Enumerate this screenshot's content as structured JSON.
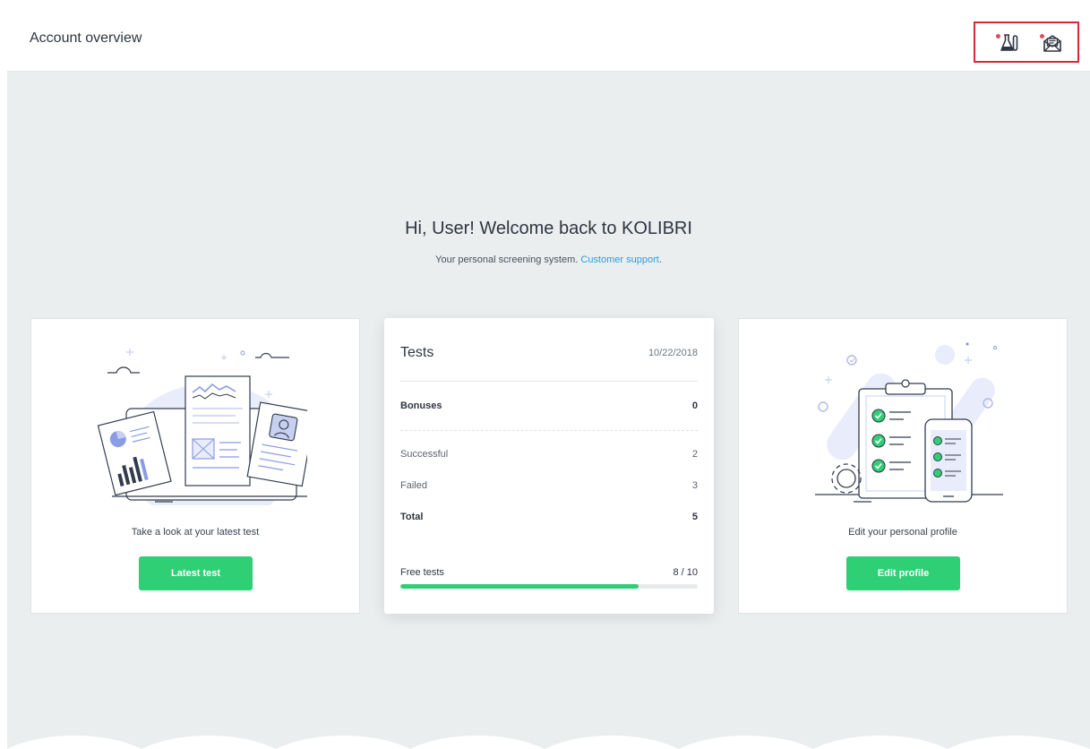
{
  "header": {
    "title": "Account overview",
    "icons": [
      "flask-icon",
      "message-icon"
    ],
    "highlight_color": "#d8273b"
  },
  "welcome": {
    "heading": "Hi, User! Welcome back to KOLIBRI",
    "subtitle_text": "Your personal screening system.",
    "support_link": "Customer support",
    "support_suffix": "."
  },
  "latest_card": {
    "caption": "Take a look at your latest test",
    "button_label": "Latest test"
  },
  "tests_card": {
    "title": "Tests",
    "date": "10/22/2018",
    "bonuses_label": "Bonuses",
    "bonuses_value": "0",
    "successful_label": "Successful",
    "successful_value": "2",
    "failed_label": "Failed",
    "failed_value": "3",
    "total_label": "Total",
    "total_value": "5",
    "free_tests_label": "Free tests",
    "free_tests_value": "8 / 10",
    "free_tests_fraction": 0.8
  },
  "profile_card": {
    "caption": "Edit your personal profile",
    "button_label": "Edit profile"
  },
  "colors": {
    "accent_green": "#2fcf75",
    "link_blue": "#2a9fd6",
    "background": "#ebeeee",
    "notification_dot": "#e14b5f"
  }
}
